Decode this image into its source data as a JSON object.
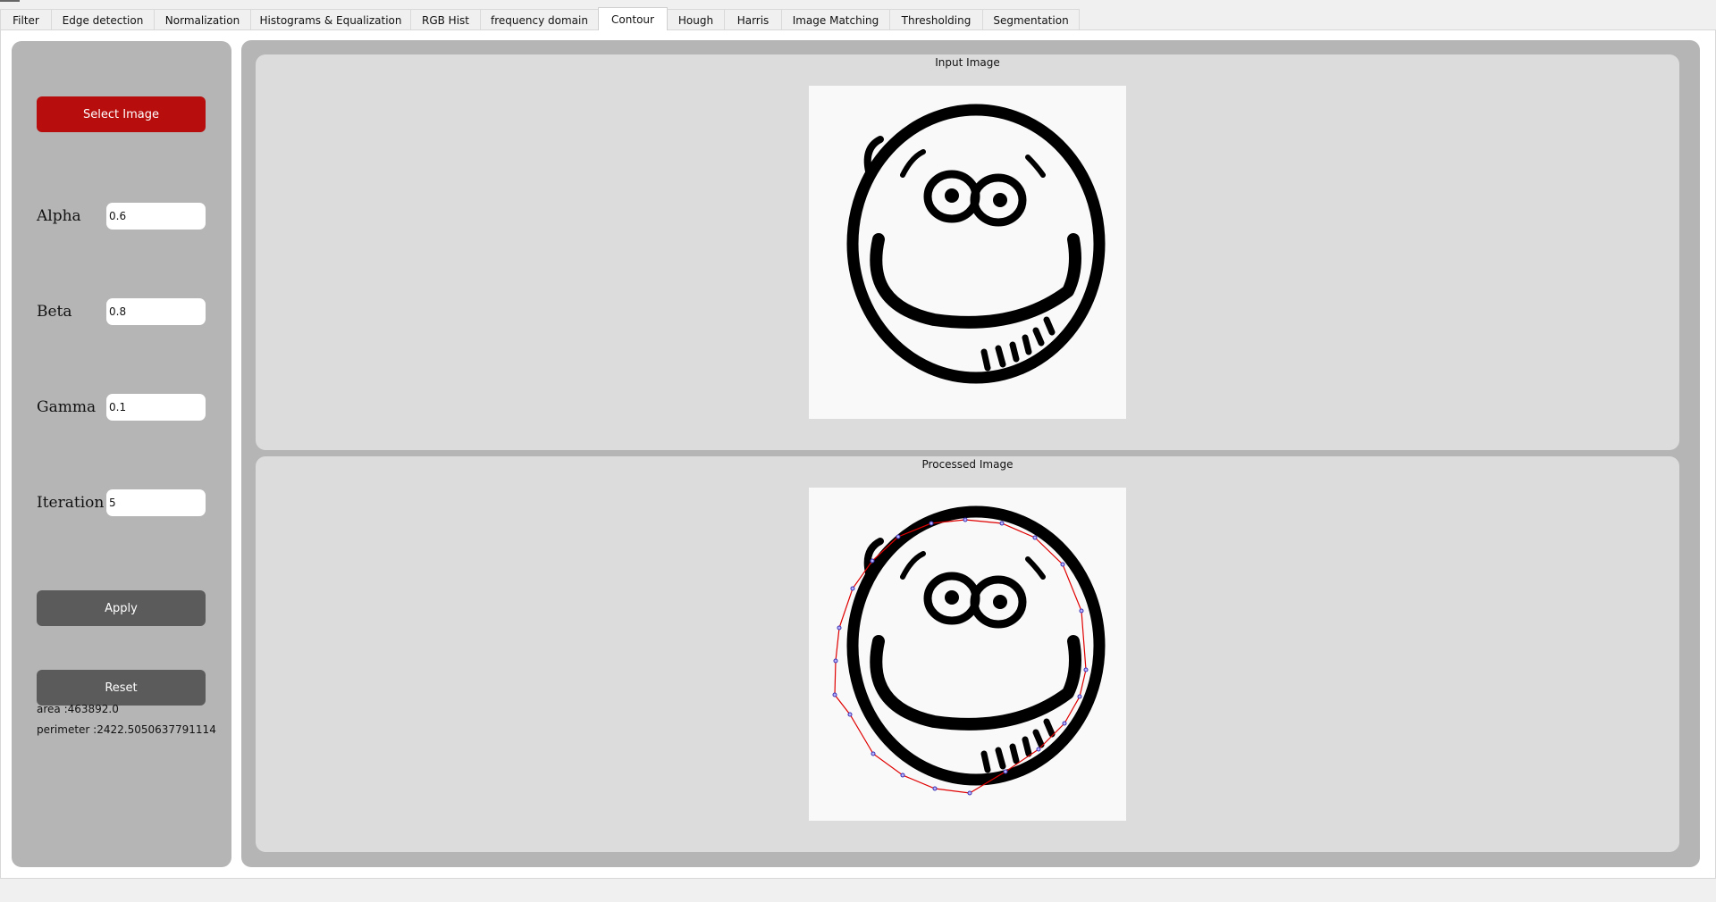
{
  "tabs": [
    {
      "label": "Filter"
    },
    {
      "label": "Edge detection"
    },
    {
      "label": "Normalization"
    },
    {
      "label": "Histograms & Equalization"
    },
    {
      "label": "RGB Hist"
    },
    {
      "label": "frequency domain"
    },
    {
      "label": "Contour",
      "active": true
    },
    {
      "label": "Hough"
    },
    {
      "label": "Harris"
    },
    {
      "label": "Image Matching"
    },
    {
      "label": "Thresholding"
    },
    {
      "label": "Segmentation"
    }
  ],
  "sidebar": {
    "select_image_label": "Select Image",
    "params": [
      {
        "label": "Alpha",
        "value": "0.6"
      },
      {
        "label": "Beta",
        "value": "0.8"
      },
      {
        "label": "Gamma",
        "value": "0.1"
      },
      {
        "label": "Iteration",
        "value": "5"
      }
    ],
    "apply_label": "Apply",
    "reset_label": "Reset",
    "area_text": "area :463892.0",
    "perimeter_text": "perimeter :2422.5050637791114"
  },
  "panels": {
    "input_title": "Input Image",
    "processed_title": "Processed Image"
  },
  "colors": {
    "accent_red": "#b70d0d",
    "button_grey": "#5b5b5b",
    "contour_line": "#e00000",
    "contour_points": "#5a4fd6"
  }
}
